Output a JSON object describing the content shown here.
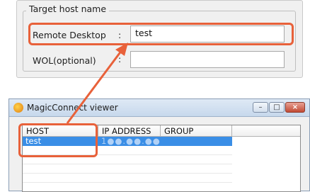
{
  "settings": {
    "group_title": "Target host name",
    "fields": [
      {
        "label": "Remote Desktop",
        "colon": ":",
        "value": "test"
      },
      {
        "label": "WOL(optional)",
        "colon": ":",
        "value": ""
      }
    ]
  },
  "viewer": {
    "title": "MagicConnect viewer",
    "window_buttons": {
      "minimize": "–",
      "maximize": "□",
      "close": "×"
    },
    "columns": [
      "HOST",
      "IP ADDRESS",
      "GROUP"
    ],
    "rows": [
      {
        "host": "test",
        "ip": "1●●.●●.●●",
        "group": "",
        "selected": true
      }
    ]
  },
  "colors": {
    "highlight": "#e8613a",
    "selection": "#3a8ee6"
  }
}
